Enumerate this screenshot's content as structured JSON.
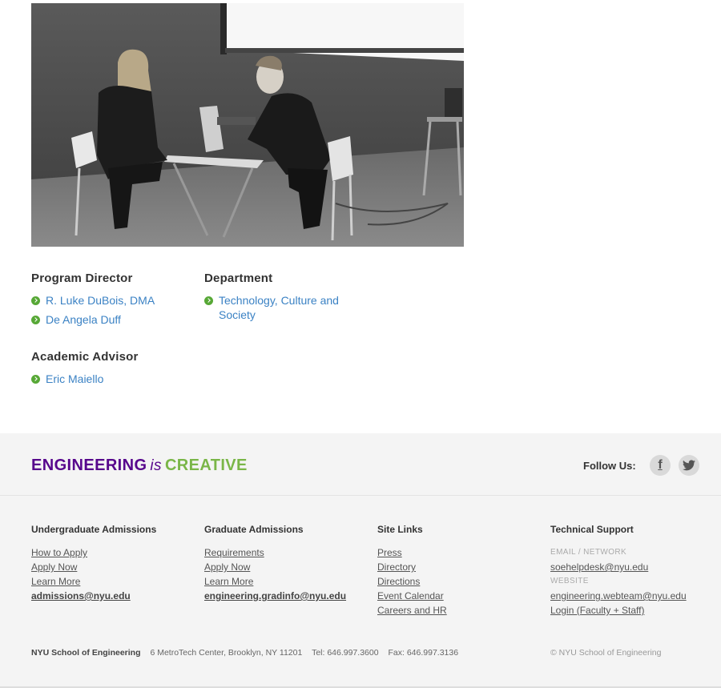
{
  "photo": {
    "alt_icon": "photo-performers"
  },
  "program_director": {
    "heading": "Program Director",
    "links": [
      "R. Luke DuBois, DMA",
      "De Angela Duff"
    ]
  },
  "department": {
    "heading": "Department",
    "links": [
      "Technology, Culture and Society"
    ]
  },
  "academic_advisor": {
    "heading": "Academic Advisor",
    "links": [
      "Eric Maiello"
    ]
  },
  "footer": {
    "tagline_engineering": "ENGINEERING",
    "tagline_is": "is",
    "tagline_creative": "CREATIVE",
    "follow_label": "Follow Us:",
    "undergrad": {
      "heading": "Undergraduate Admissions",
      "links": [
        "How to Apply",
        "Apply Now",
        "Learn More"
      ],
      "email": "admissions@nyu.edu"
    },
    "graduate": {
      "heading": "Graduate Admissions",
      "links": [
        "Requirements",
        "Apply Now",
        "Learn More"
      ],
      "email": "engineering.gradinfo@nyu.edu"
    },
    "site_links": {
      "heading": "Site Links",
      "links": [
        "Press",
        "Directory",
        "Directions",
        "Event Calendar",
        "Careers and HR"
      ]
    },
    "tech_support": {
      "heading": "Technical Support",
      "label1": "EMAIL / NETWORK",
      "link1": "soehelpdesk@nyu.edu",
      "label2": "WEBSITE",
      "link2": "engineering.webteam@nyu.edu",
      "link3": "Login (Faculty + Staff)"
    },
    "bottom": {
      "school": "NYU School of Engineering",
      "address": "6 MetroTech Center, Brooklyn, NY 11201",
      "tel": "Tel: 646.997.3600",
      "fax": "Fax: 646.997.3136",
      "copyright": "© NYU School of Engineering"
    }
  },
  "colors": {
    "purple": "#57068c",
    "green": "#7ab648",
    "link_blue": "#3b82c4",
    "bullet_green": "#57a836"
  }
}
